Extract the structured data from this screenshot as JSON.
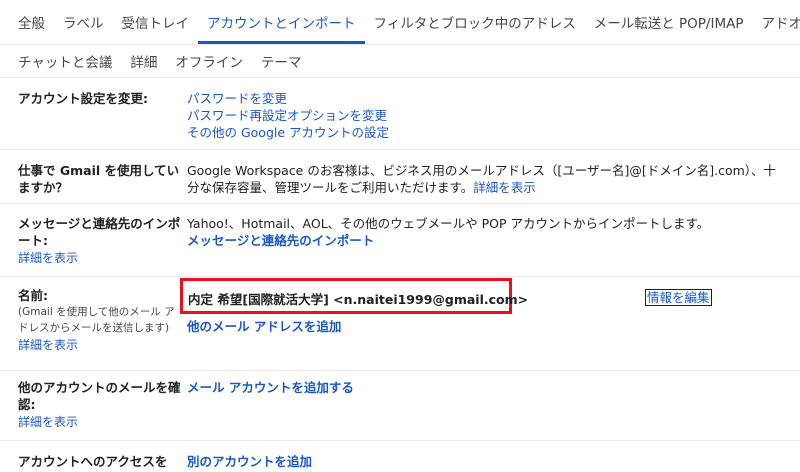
{
  "tabs_row1": [
    "全般",
    "ラベル",
    "受信トレイ",
    "アカウントとインポート",
    "フィルタとブロック中のアドレス",
    "メール転送と POP/IMAP",
    "アドオン"
  ],
  "tabs_row2": [
    "チャットと会議",
    "詳細",
    "オフライン",
    "テーマ"
  ],
  "active_tab": "アカウントとインポート",
  "change_settings": {
    "label": "アカウント設定を変更:",
    "links": [
      "パスワードを変更",
      "パスワード再設定オプションを変更",
      "その他の Google アカウントの設定"
    ]
  },
  "workspace": {
    "label": "仕事で Gmail を使用していますか？",
    "text": "Google Workspace のお客様は、ビジネス用のメールアドレス（[ユーザー名]@[ドメイン名].com）、十分な保存容量、管理ツールをご利用いただけます。",
    "link": "詳細を表示"
  },
  "import": {
    "label": "メッセージと連絡先のインポート:",
    "help": "詳細を表示",
    "text": "Yahoo!、Hotmail、AOL、その他のウェブメールや POP アカウントからインポートします。",
    "link": "メッセージと連絡先のインポート"
  },
  "name": {
    "label": "名前:",
    "sub": "(Gmail を使用して他のメール アドレスからメールを送信します)",
    "help": "詳細を表示",
    "value": "内定 希望[国際就活大学] <n.naitei1999@gmail.com>",
    "add_link": "他のメール アドレスを追加",
    "edit_link": "情報を編集"
  },
  "check_mail": {
    "label": "他のアカウントのメールを確認:",
    "help": "詳細を表示",
    "link": "メール アカウントを追加する"
  },
  "grant_access": {
    "label": "アカウントへのアクセスを",
    "link": "別のアカウントを追加"
  },
  "colors": {
    "link": "#1a57c4",
    "highlight_box": "#e8101a",
    "text": "#202124"
  }
}
